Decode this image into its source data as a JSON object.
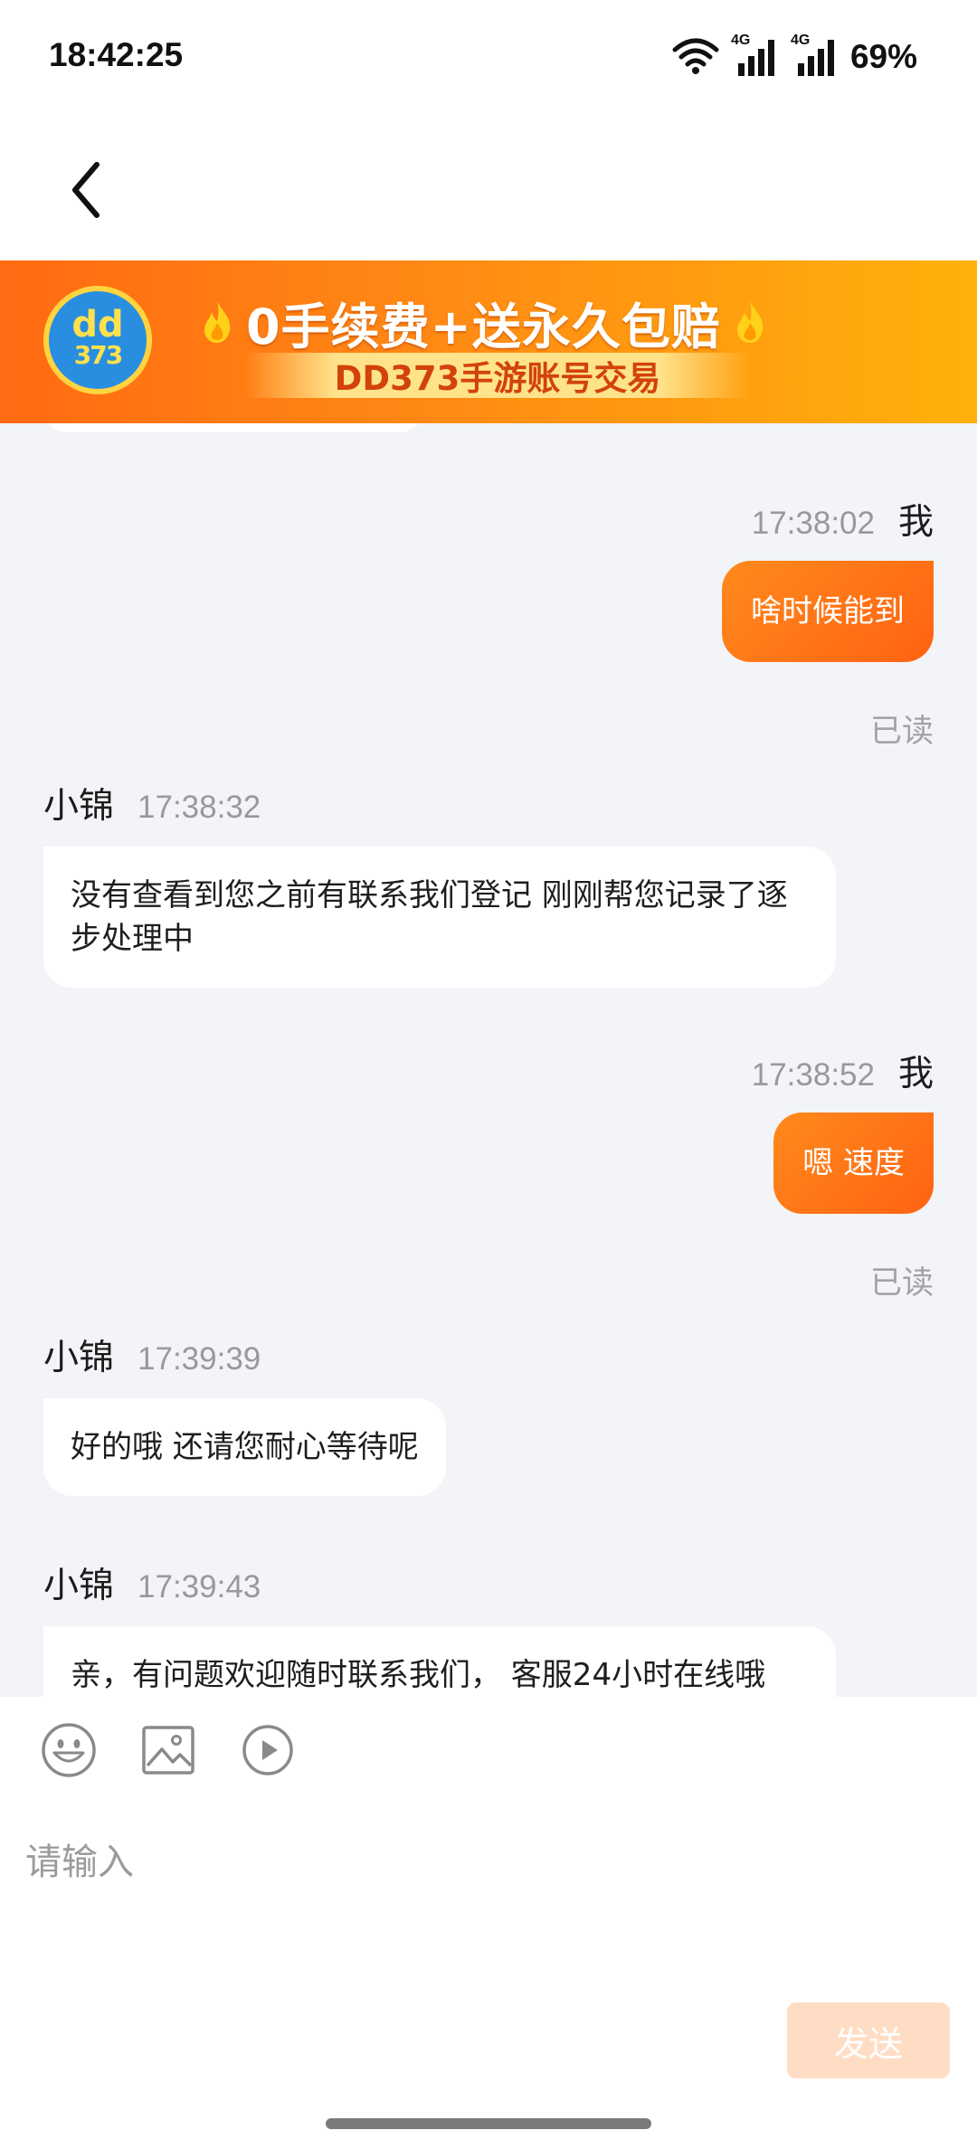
{
  "status_bar": {
    "time": "18:42:25",
    "signal_1_label": "4G",
    "signal_2_label": "4G",
    "battery": "69%"
  },
  "nav": {
    "back_icon": "chevron-left-icon"
  },
  "banner": {
    "logo_top": "dd",
    "logo_bottom": "373",
    "title": "0手续费+送永久包赔",
    "subtitle": "DD373手游账号交易",
    "colors": {
      "start": "#ff6a12",
      "end": "#ffb10a"
    }
  },
  "chat": {
    "messages": [
      {
        "direction": "out",
        "sender": "我",
        "time": "17:38:02",
        "text": "啥时候能到",
        "status": "已读"
      },
      {
        "direction": "in",
        "sender": "小锦",
        "time": "17:38:32",
        "text": "没有查看到您之前有联系我们登记  刚刚帮您记录了逐步处理中"
      },
      {
        "direction": "out",
        "sender": "我",
        "time": "17:38:52",
        "text": "嗯 速度",
        "status": "已读"
      },
      {
        "direction": "in",
        "sender": "小锦",
        "time": "17:39:39",
        "text": "好的哦 还请您耐心等待呢"
      },
      {
        "direction": "in",
        "sender": "小锦",
        "time": "17:39:43",
        "text": "亲，有问题欢迎随时联系我们， 客服24小时在线哦"
      }
    ]
  },
  "composer": {
    "placeholder": "请输入",
    "send_label": "发送",
    "tools": [
      "emoji-icon",
      "image-icon",
      "video-icon"
    ]
  },
  "colors": {
    "accent": "#ff6a12",
    "chat_background": "#f3f4f8",
    "send_disabled": "#ffddc4"
  }
}
